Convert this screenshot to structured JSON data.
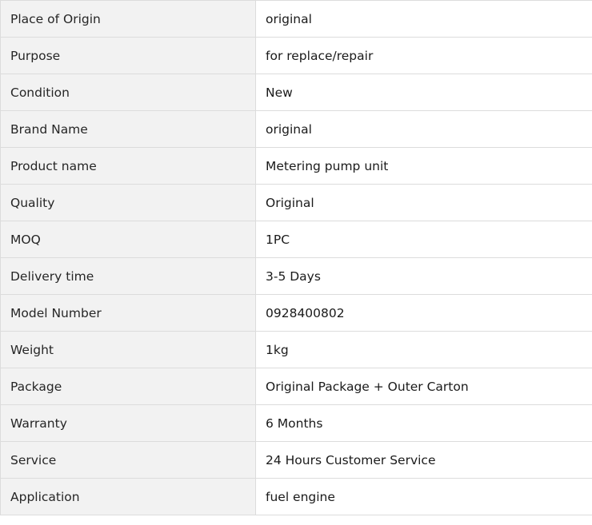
{
  "specs": [
    {
      "label": "Place of Origin",
      "value": "original"
    },
    {
      "label": "Purpose",
      "value": "for replace/repair"
    },
    {
      "label": "Condition",
      "value": "New"
    },
    {
      "label": "Brand Name",
      "value": "original"
    },
    {
      "label": "Product name",
      "value": "Metering pump unit"
    },
    {
      "label": "Quality",
      "value": "Original"
    },
    {
      "label": "MOQ",
      "value": "1PC"
    },
    {
      "label": "Delivery time",
      "value": "3-5 Days"
    },
    {
      "label": "Model Number",
      "value": "0928400802"
    },
    {
      "label": "Weight",
      "value": "1kg"
    },
    {
      "label": "Package",
      "value": "Original Package + Outer Carton"
    },
    {
      "label": "Warranty",
      "value": "6 Months"
    },
    {
      "label": "Service",
      "value": "24 Hours Customer Service"
    },
    {
      "label": "Application",
      "value": "fuel engine"
    }
  ]
}
